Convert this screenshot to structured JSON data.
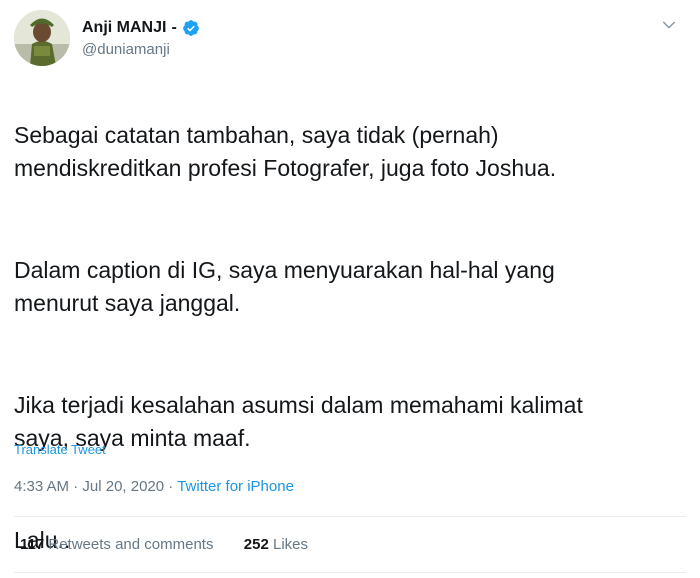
{
  "author": {
    "display_name": "Anji MANJI",
    "name_suffix": "-",
    "handle": "@duniamanji"
  },
  "tweet": {
    "paragraphs": [
      "Sebagai catatan tambahan, saya tidak (pernah)\nmendiskreditkan profesi Fotografer, juga foto Joshua.",
      "Dalam caption di IG, saya menyuarakan hal-hal yang\nmenurut saya janggal.",
      "Jika terjadi kesalahan asumsi dalam memahami kalimat\nsaya, saya minta maaf.",
      "Lalu.."
    ],
    "translate_label": "Translate Tweet"
  },
  "meta": {
    "time": "4:33 AM",
    "separator": "·",
    "date": "Jul 20, 2020",
    "source": "Twitter for iPhone"
  },
  "stats": {
    "retweets_count": "117",
    "retweets_label": "Retweets and comments",
    "likes_count": "252",
    "likes_label": "Likes"
  },
  "colors": {
    "accent": "#1b95e0",
    "verified": "#1da1f2",
    "muted_text": "#657786",
    "divider": "#e6ecf0"
  },
  "icons": {
    "verified": "verified-badge-icon",
    "caret": "chevron-down-icon"
  }
}
